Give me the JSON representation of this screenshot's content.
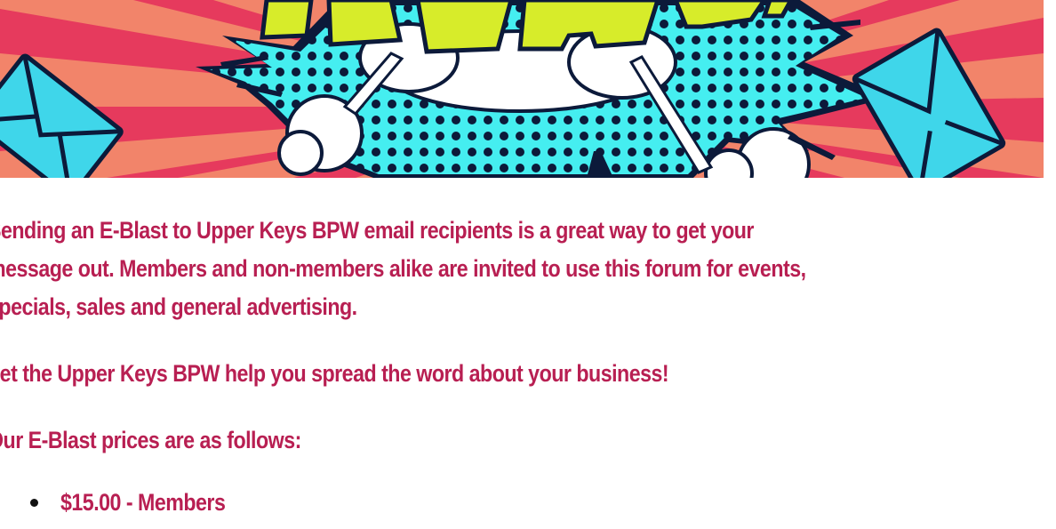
{
  "banner": {
    "title_fragment": "IDEAS!",
    "colors": {
      "background": "#f06a55",
      "rays": "#e8345a",
      "burst": "#45eef0",
      "title": "#d7ec2a",
      "envelope": "#3fd6ea"
    }
  },
  "intro": {
    "line1": "Sending an E-Blast to Upper Keys BPW email recipients is a great way to get your",
    "line2": "message out. Members and non-members alike are invited to use this forum for events,",
    "line3": "specials, sales and general advertising."
  },
  "promo": "Let the Upper Keys BPW help you spread the word about your business!",
  "prices_heading": "Our E-Blast prices are as follows:",
  "prices": [
    {
      "text": "$15.00  -  Members"
    }
  ],
  "colors": {
    "text": "#b81f52",
    "bullet": "#111111"
  }
}
